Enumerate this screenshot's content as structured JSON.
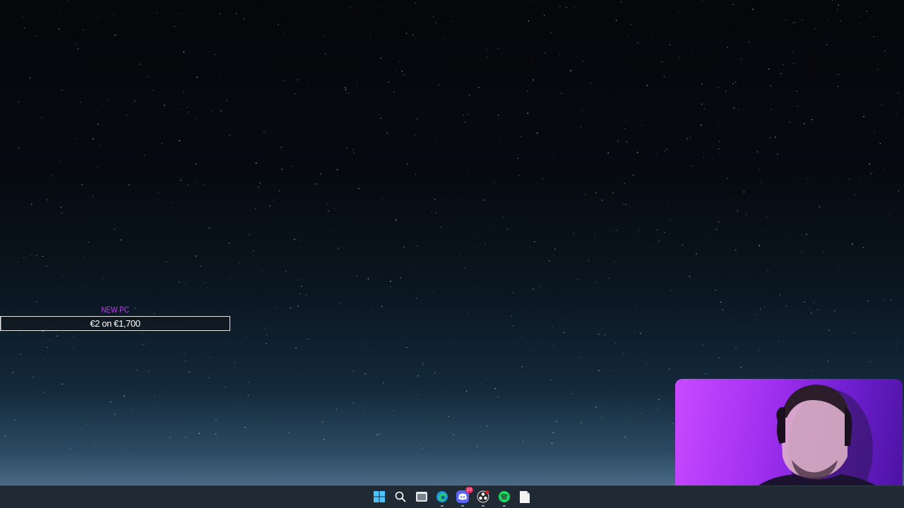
{
  "goal": {
    "title": "NEW PC",
    "progress_text": "€2 on €1,700",
    "current": 2,
    "target": 1700,
    "accent_color": "#b040e0"
  },
  "webcam": {
    "description_icon": "webcam-overlay"
  },
  "taskbar": {
    "icons": [
      {
        "name": "start-icon"
      },
      {
        "name": "search-icon"
      },
      {
        "name": "file-explorer-icon"
      },
      {
        "name": "edge-icon"
      },
      {
        "name": "discord-icon",
        "badge": "20"
      },
      {
        "name": "obs-icon"
      },
      {
        "name": "spotify-icon"
      },
      {
        "name": "notepad-icon"
      }
    ]
  }
}
